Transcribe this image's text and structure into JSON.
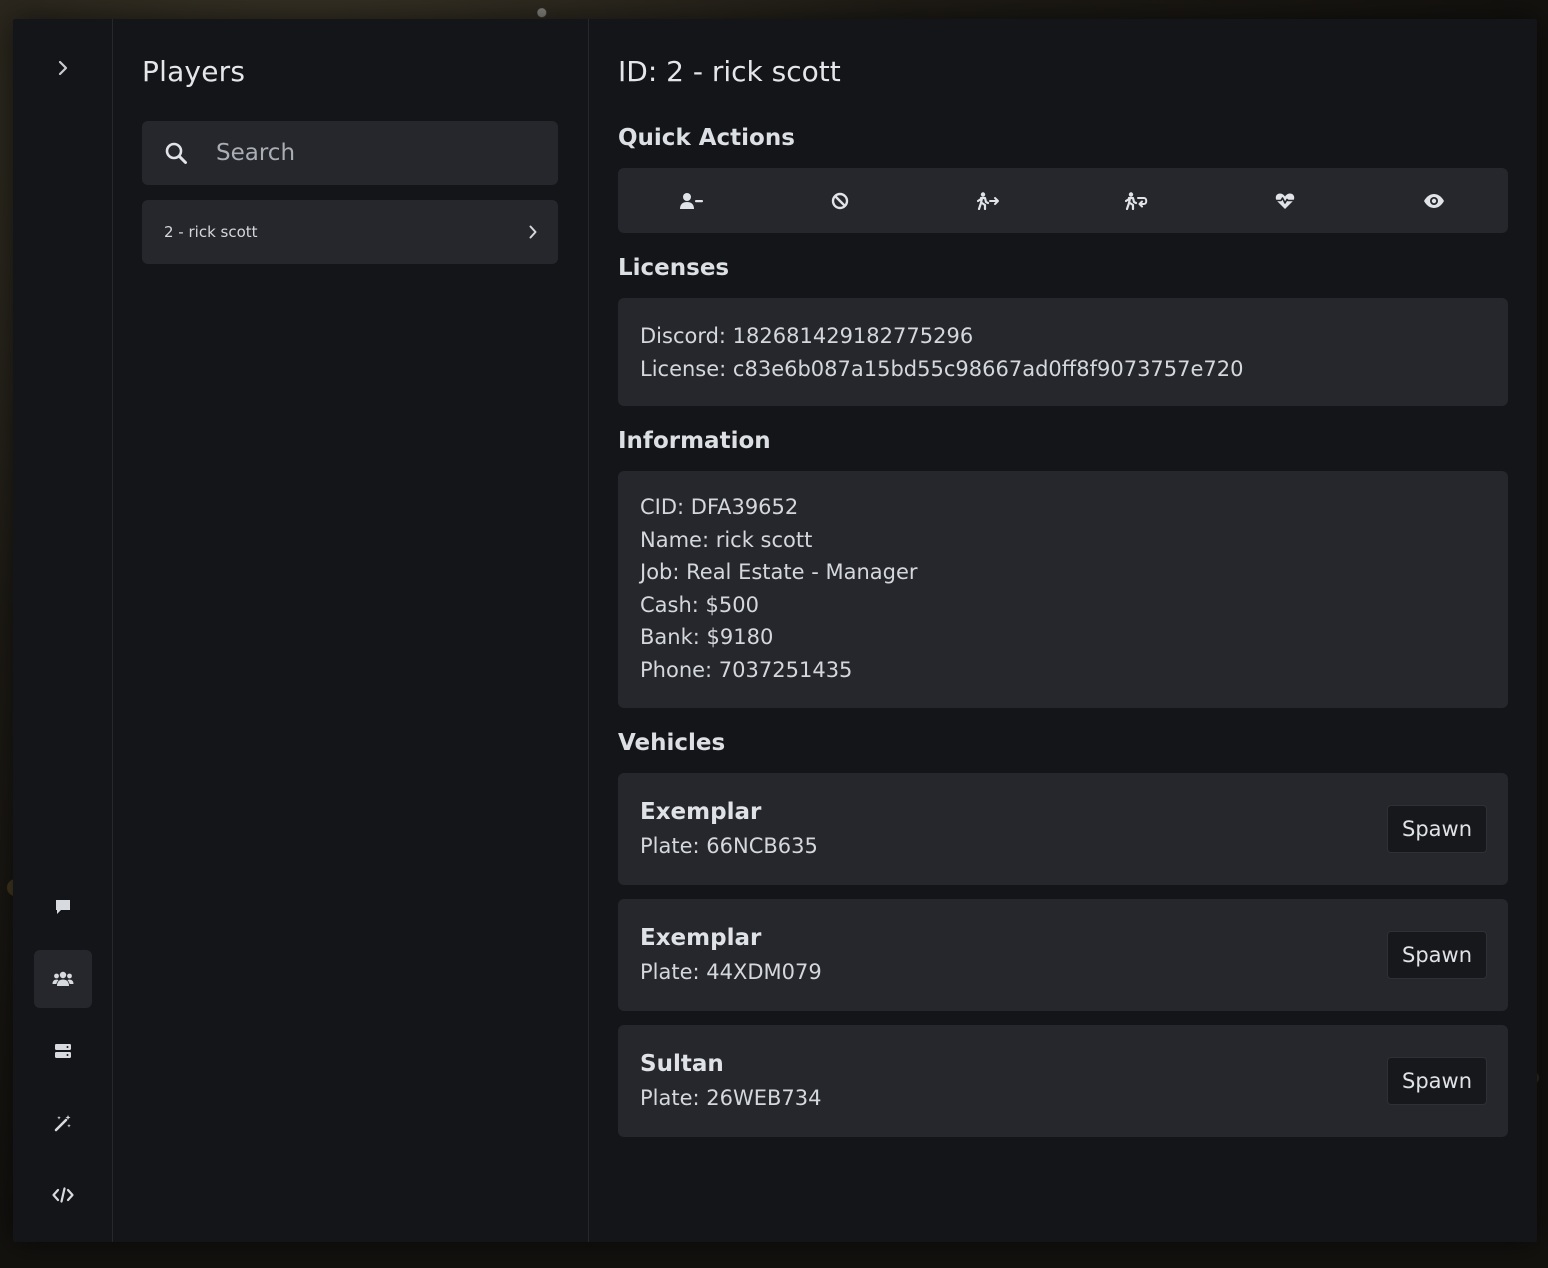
{
  "sidebar": {
    "toggle_icon": "chevron-right-icon",
    "items": [
      {
        "name": "chat",
        "icon": "chat-icon",
        "active": false
      },
      {
        "name": "players",
        "icon": "users-icon",
        "active": true
      },
      {
        "name": "server",
        "icon": "server-icon",
        "active": false
      },
      {
        "name": "tools",
        "icon": "magic-wand-icon",
        "active": false
      },
      {
        "name": "developer",
        "icon": "code-icon",
        "active": false
      }
    ]
  },
  "players_panel": {
    "title": "Players",
    "search": {
      "placeholder": "Search",
      "value": ""
    },
    "list": [
      {
        "label": "2 - rick scott"
      }
    ]
  },
  "details": {
    "title": "ID: 2 - rick scott",
    "quick_actions": {
      "title": "Quick Actions",
      "items": [
        {
          "name": "kick",
          "icon": "user-minus-icon"
        },
        {
          "name": "ban",
          "icon": "ban-icon"
        },
        {
          "name": "teleport-to",
          "icon": "person-arrow-right-icon"
        },
        {
          "name": "bring",
          "icon": "person-arrow-return-icon"
        },
        {
          "name": "revive",
          "icon": "heart-pulse-icon"
        },
        {
          "name": "spectate",
          "icon": "eye-icon"
        }
      ]
    },
    "licenses": {
      "title": "Licenses",
      "discord": "Discord: 182681429182775296",
      "license": "License: c83e6b087a15bd55c98667ad0ff8f9073757e720"
    },
    "information": {
      "title": "Information",
      "cid": "CID: DFA39652",
      "name": "Name: rick scott",
      "job": "Job: Real Estate - Manager",
      "cash": "Cash: $500",
      "bank": "Bank: $9180",
      "phone": "Phone: 7037251435"
    },
    "vehicles": {
      "title": "Vehicles",
      "spawn_label": "Spawn",
      "items": [
        {
          "model": "Exemplar",
          "plate": "Plate: 66NCB635"
        },
        {
          "model": "Exemplar",
          "plate": "Plate: 44XDM079"
        },
        {
          "model": "Sultan",
          "plate": "Plate: 26WEB734"
        }
      ]
    }
  },
  "colors": {
    "panel": "#141518",
    "card": "#25272c",
    "text": "#d4d7dc",
    "button": "#17181b"
  }
}
